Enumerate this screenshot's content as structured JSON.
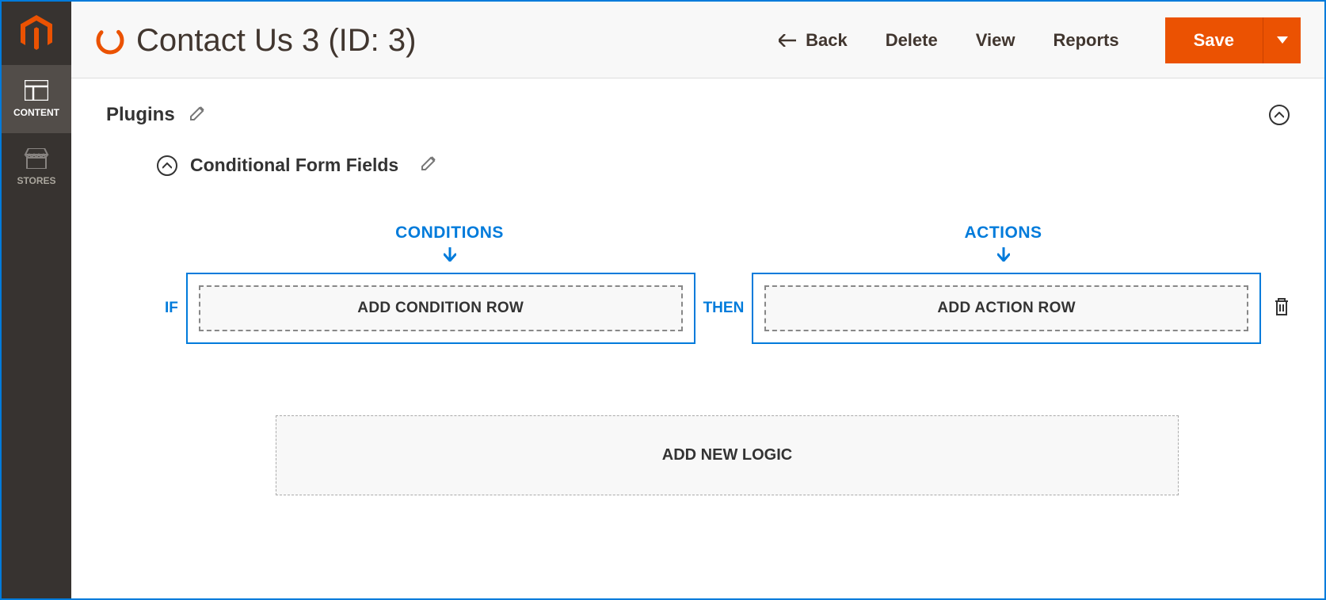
{
  "sidebar": {
    "items": [
      {
        "label": "CONTENT"
      },
      {
        "label": "STORES"
      }
    ]
  },
  "header": {
    "title": "Contact Us 3 (ID: 3)",
    "back": "Back",
    "delete": "Delete",
    "view": "View",
    "reports": "Reports",
    "save": "Save"
  },
  "plugins": {
    "title": "Plugins",
    "conditional": {
      "title": "Conditional Form Fields",
      "conditions_label": "CONDITIONS",
      "actions_label": "ACTIONS",
      "if_label": "IF",
      "then_label": "THEN",
      "add_condition": "ADD CONDITION ROW",
      "add_action": "ADD ACTION ROW",
      "add_logic": "ADD NEW LOGIC"
    }
  }
}
